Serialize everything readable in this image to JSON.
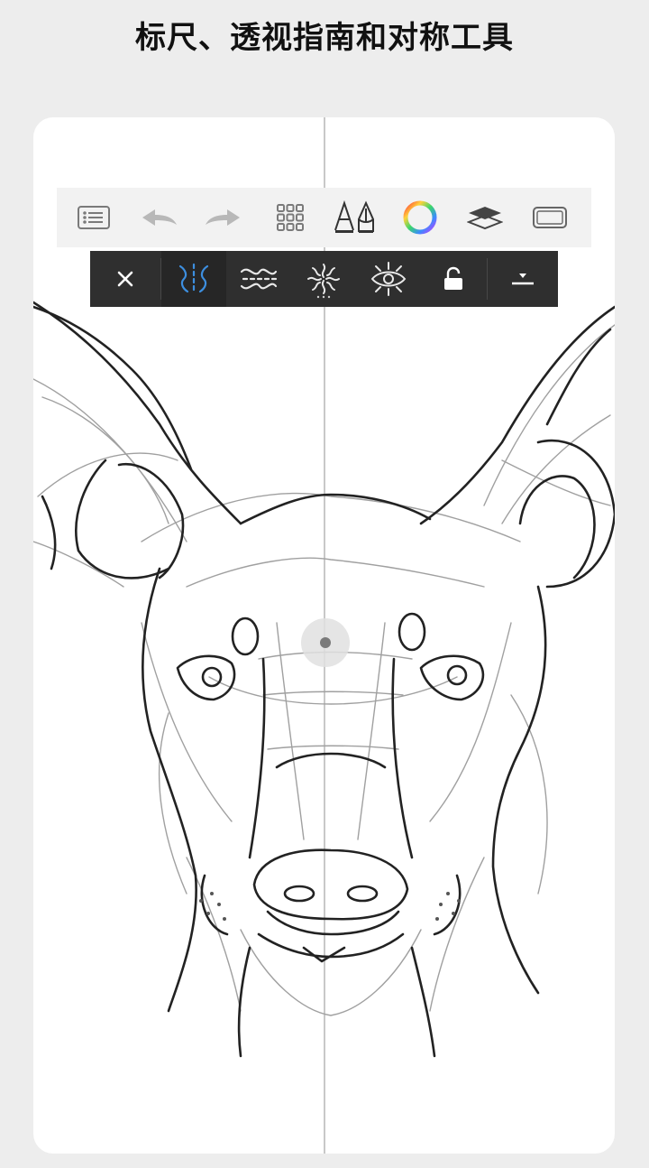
{
  "promo": {
    "title": "标尺、透视指南和对称工具"
  },
  "toolbar": {
    "items": [
      {
        "name": "list-icon"
      },
      {
        "name": "undo-icon"
      },
      {
        "name": "redo-icon"
      },
      {
        "name": "grid-icon"
      },
      {
        "name": "brush-pen-icon"
      },
      {
        "name": "color-wheel-icon"
      },
      {
        "name": "layers-icon"
      },
      {
        "name": "canvas-frame-icon"
      }
    ]
  },
  "symmetry_toolbar": {
    "items": [
      {
        "name": "close-icon"
      },
      {
        "name": "mirror-symmetry-icon",
        "active": true
      },
      {
        "name": "wave-symmetry-icon"
      },
      {
        "name": "radial-symmetry-icon"
      },
      {
        "name": "kaleidoscope-symmetry-icon"
      },
      {
        "name": "lock-open-icon"
      },
      {
        "name": "collapse-icon"
      }
    ],
    "accent_color": "#3d8fe0"
  },
  "canvas": {
    "symmetry_axis_color": "#c8c8c8",
    "sketch_stroke_color": "#222222",
    "guide_stroke_color": "#9a9a9a"
  }
}
